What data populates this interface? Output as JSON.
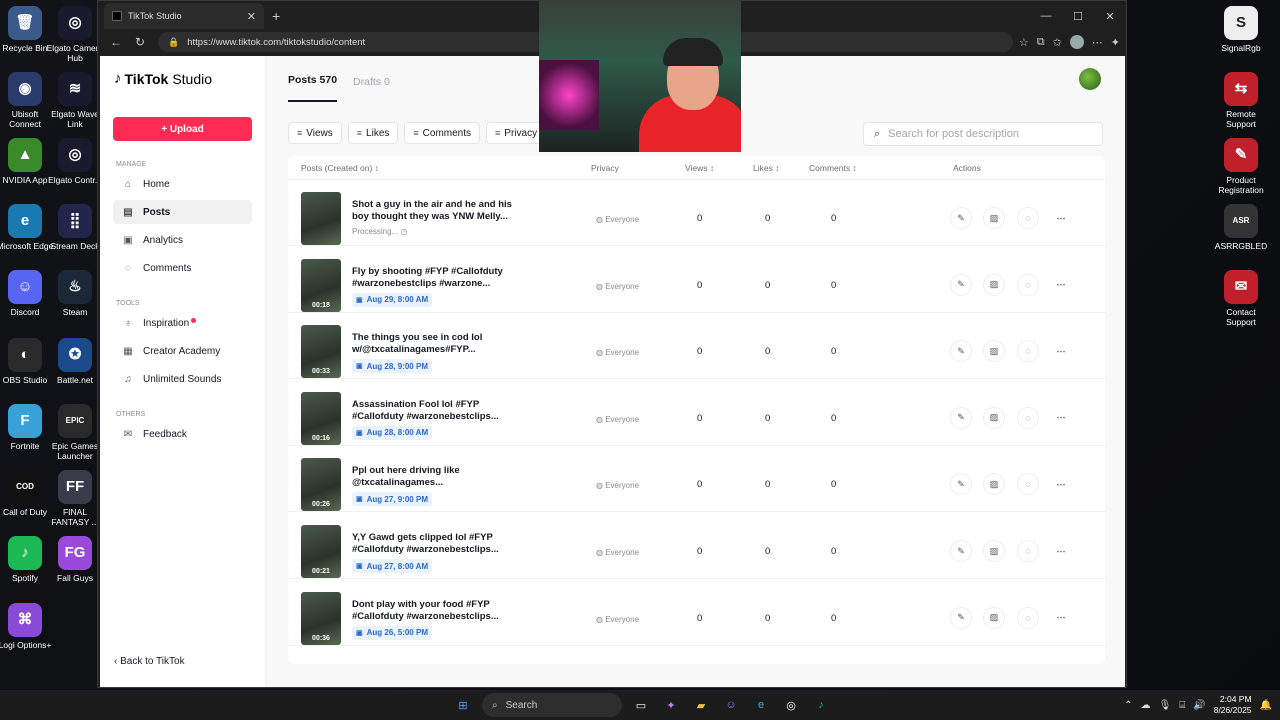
{
  "desktop": {
    "left_icons": [
      {
        "label": "Recycle Bin",
        "glyph": "🗑",
        "color": "#3a5a8a"
      },
      {
        "label": "Elgato Camera Hub",
        "glyph": "◎",
        "color": "#1a1a2e"
      },
      {
        "label": "Ubisoft Connect",
        "glyph": "◉",
        "color": "#2a3a6a"
      },
      {
        "label": "Elgato Wave Link",
        "glyph": "≋",
        "color": "#1a1a2e"
      },
      {
        "label": "NVIDIA App",
        "glyph": "▲",
        "color": "#3a8a2a"
      },
      {
        "label": "Elgato Contr...",
        "glyph": "◎",
        "color": "#1a1a2e"
      },
      {
        "label": "Microsoft Edge",
        "glyph": "e",
        "color": "#1a7ab0"
      },
      {
        "label": "Stream Deck",
        "glyph": "⣿",
        "color": "#22264a"
      },
      {
        "label": "Discord",
        "glyph": "☺",
        "color": "#5865f2"
      },
      {
        "label": "Steam",
        "glyph": "♨",
        "color": "#1b2838"
      },
      {
        "label": "OBS Studio",
        "glyph": "◐",
        "color": "#2a2a2a"
      },
      {
        "label": "Battle.net",
        "glyph": "✪",
        "color": "#1a4a8a"
      },
      {
        "label": "Fortnite",
        "glyph": "F",
        "color": "#3aa0d8"
      },
      {
        "label": "Epic Games Launcher",
        "glyph": "EPIC",
        "color": "#2a2a2a"
      },
      {
        "label": "Call of Duty",
        "glyph": "COD",
        "color": "#111"
      },
      {
        "label": "FINAL FANTASY ...",
        "glyph": "FF",
        "color": "#3a3a4a"
      },
      {
        "label": "Spotify",
        "glyph": "♪",
        "color": "#1db954"
      },
      {
        "label": "Fall Guys",
        "glyph": "FG",
        "color": "#9a4ad8"
      },
      {
        "label": "Logi Options+",
        "glyph": "⌘",
        "color": "#8a4ad8"
      }
    ],
    "right_icons": [
      {
        "label": "SignalRgb",
        "glyph": "S",
        "color": "#eee"
      },
      {
        "label": "Remote Support",
        "glyph": "⇆",
        "color": "#c0202a"
      },
      {
        "label": "Product Registration",
        "glyph": "✎",
        "color": "#c0202a"
      },
      {
        "label": "ASRRGBLED",
        "glyph": "ASR",
        "color": "#333"
      },
      {
        "label": "Contact Support",
        "glyph": "✉",
        "color": "#c0202a"
      }
    ]
  },
  "browser": {
    "tab_title": "TikTok Studio",
    "url": "https://www.tiktok.com/tiktokstudio/content"
  },
  "sidebar": {
    "logo_main": "TikTok",
    "logo_sub": "Studio",
    "upload_label": "+ Upload",
    "manage_label": "MANAGE",
    "home": "Home",
    "posts": "Posts",
    "analytics": "Analytics",
    "comments": "Comments",
    "tools_label": "TOOLS",
    "inspiration": "Inspiration",
    "academy": "Creator Academy",
    "sounds": "Unlimited Sounds",
    "others_label": "OTHERS",
    "feedback": "Feedback",
    "back": "Back to TikTok"
  },
  "main": {
    "tab_posts": "Posts 570",
    "tab_drafts": "Drafts 0",
    "filters": {
      "views": "Views",
      "likes": "Likes",
      "comments": "Comments",
      "privacy": "Privacy"
    },
    "search_placeholder": "Search for post description",
    "columns": {
      "posts": "Posts (Created on)",
      "privacy": "Privacy",
      "views": "Views",
      "likes": "Likes",
      "comments": "Comments",
      "actions": "Actions"
    }
  },
  "posts": [
    {
      "title": "Shot a guy in the air and he and his boy thought they was YNW Melly...",
      "status": "Processing...",
      "date": "",
      "duration": "",
      "privacy": "Everyone",
      "views": "0",
      "likes": "0",
      "comments": "0"
    },
    {
      "title": "Fly by shooting #FYP #Callofduty #warzonebestclips #warzone...",
      "status": "",
      "date": "Aug 29, 8:00 AM",
      "duration": "00:18",
      "privacy": "Everyone",
      "views": "0",
      "likes": "0",
      "comments": "0"
    },
    {
      "title": "The things you see in cod lol w/@txcatalinagames#FYP...",
      "status": "",
      "date": "Aug 28, 9:00 PM",
      "duration": "00:33",
      "privacy": "Everyone",
      "views": "0",
      "likes": "0",
      "comments": "0"
    },
    {
      "title": "Assassination Fool lol #FYP #Callofduty #warzonebestclips...",
      "status": "",
      "date": "Aug 28, 8:00 AM",
      "duration": "00:16",
      "privacy": "Everyone",
      "views": "0",
      "likes": "0",
      "comments": "0"
    },
    {
      "title": "Ppl out here driving like @txcatalinagames...",
      "status": "",
      "date": "Aug 27, 9:00 PM",
      "duration": "00:26",
      "privacy": "Everyone",
      "views": "0",
      "likes": "0",
      "comments": "0"
    },
    {
      "title": "Y,Y Gawd gets clipped lol #FYP #Callofduty #warzonebestclips...",
      "status": "",
      "date": "Aug 27, 8:00 AM",
      "duration": "00:21",
      "privacy": "Everyone",
      "views": "0",
      "likes": "0",
      "comments": "0"
    },
    {
      "title": "Dont play with your food #FYP #Callofduty #warzonebestclips...",
      "status": "",
      "date": "Aug 26, 5:00 PM",
      "duration": "00:36",
      "privacy": "Everyone",
      "views": "0",
      "likes": "0",
      "comments": "0"
    }
  ],
  "taskbar": {
    "search": "Search",
    "time": "2:04 PM",
    "date": "8/26/2025"
  }
}
